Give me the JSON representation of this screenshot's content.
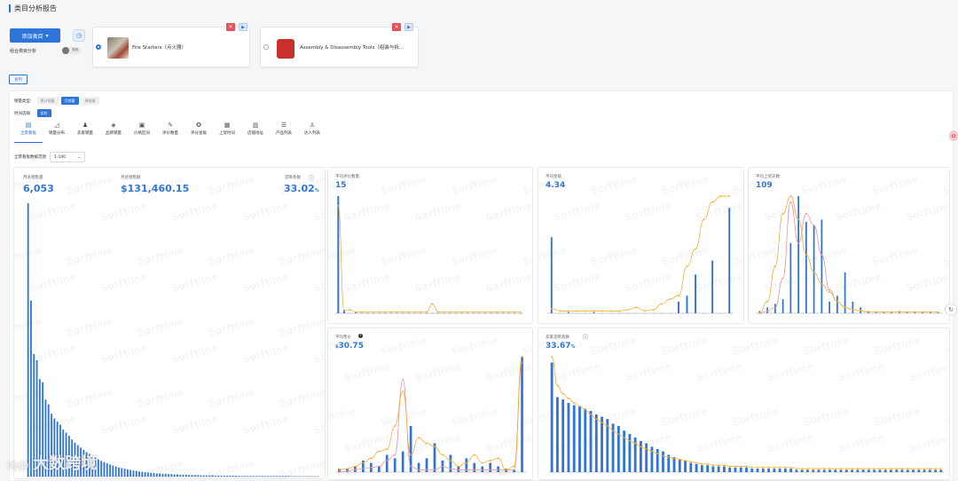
{
  "page": {
    "title": "类目分析报告"
  },
  "top": {
    "add_button": "添加类目",
    "combo_label": "组合类目分析",
    "toggle_text": "关闭",
    "categories": [
      {
        "name": "Fire Starters（点火器）",
        "selected": true
      },
      {
        "name": "Assembly & Disassembly Tools（组装与拆…",
        "selected": false
      }
    ],
    "list_tag": "发列"
  },
  "filters": {
    "sales_type_label": "销量类型:",
    "sales_types": [
      "累计销量",
      "月销量",
      "周销量"
    ],
    "sales_type_active": "月销量",
    "time_label": "时间选择:",
    "time_value": "实时"
  },
  "tabs": [
    {
      "label": "全景看板",
      "icon": "store-icon",
      "active": true
    },
    {
      "label": "销量分布",
      "icon": "chart-icon",
      "active": false
    },
    {
      "label": "卖家销量",
      "icon": "seller-icon",
      "active": false
    },
    {
      "label": "品牌销量",
      "icon": "brand-icon",
      "active": false
    },
    {
      "label": "价格区间",
      "icon": "price-icon",
      "active": false
    },
    {
      "label": "评价数量",
      "icon": "review-icon",
      "active": false
    },
    {
      "label": "评分星级",
      "icon": "star-icon",
      "active": false
    },
    {
      "label": "上架时间",
      "icon": "calendar-icon",
      "active": false
    },
    {
      "label": "店铺地址",
      "icon": "shop-icon",
      "active": false
    },
    {
      "label": "产品列表",
      "icon": "list-icon",
      "active": false
    },
    {
      "label": "达人列表",
      "icon": "creator-icon",
      "active": false
    }
  ],
  "range": {
    "label": "全景看板数据范围",
    "value": "1-100"
  },
  "summary": {
    "monthly_units_label": "月总销售量",
    "monthly_units": "6,053",
    "monthly_revenue_label": "月总销售额",
    "monthly_revenue": "$131,460.15",
    "monopoly_label": "垄断系数",
    "monopoly_value": "33.02",
    "monopoly_unit": "%"
  },
  "cards": {
    "reviews": {
      "label": "平均评价数量",
      "value": "15"
    },
    "rating": {
      "label": "平均星级",
      "value": "4.34"
    },
    "days": {
      "label": "平均上架天数",
      "value": "109"
    },
    "price": {
      "label": "平均售价",
      "currency": "$",
      "value": "30.75"
    },
    "concentration": {
      "label": "卖家垄断系数",
      "value": "33.67",
      "unit": "%"
    }
  },
  "watermark": "Sorftime",
  "brand_watermark": "大数跨境",
  "colors": {
    "accent": "#2f74d8",
    "orange": "#f5a623",
    "pink": "#e88a9b",
    "danger": "#e8505b"
  },
  "chart_data": [
    {
      "type": "bar",
      "title": "月总销售量",
      "values": [
        870,
        560,
        390,
        370,
        310,
        300,
        245,
        230,
        200,
        185,
        175,
        165,
        150,
        140,
        130,
        118,
        108,
        100,
        92,
        85,
        78,
        72,
        66,
        60,
        55,
        50,
        46,
        42,
        38,
        35,
        32,
        29,
        27,
        25,
        23,
        21,
        19,
        18,
        16,
        15,
        14,
        13,
        12,
        11,
        10,
        10,
        9,
        9,
        8,
        8,
        7,
        7,
        6,
        6,
        6,
        5,
        5,
        5,
        5,
        4,
        4,
        4,
        4,
        4,
        3,
        3,
        3,
        3,
        3,
        3,
        3,
        3,
        2,
        2,
        2,
        2,
        2,
        2,
        2,
        2,
        2,
        2,
        2,
        2,
        2,
        2,
        2,
        2,
        2,
        2,
        1,
        1,
        1,
        1,
        1,
        1,
        1,
        1,
        1,
        1
      ]
    },
    {
      "type": "bar",
      "title": "平均评价数量",
      "values": [
        100,
        3,
        0,
        1,
        0,
        0,
        0,
        0,
        0,
        0,
        0,
        0,
        0,
        0,
        0,
        0,
        0,
        0,
        0,
        0,
        0,
        0,
        0,
        0,
        0,
        0,
        0,
        0,
        0,
        0,
        0,
        0
      ],
      "line": [
        92,
        2,
        3,
        1,
        1,
        1,
        1,
        1,
        1,
        1,
        1,
        1,
        1,
        1,
        1,
        1,
        8,
        1,
        1,
        1,
        1,
        1,
        1,
        1,
        1,
        1,
        1,
        1,
        1,
        1,
        1,
        1
      ]
    },
    {
      "type": "bar",
      "title": "平均星级",
      "values": [
        65,
        0,
        1,
        0,
        0,
        1,
        0,
        0,
        0,
        0,
        0,
        0,
        0,
        0,
        0,
        10,
        15,
        33,
        0,
        45,
        0,
        90
      ],
      "line": [
        4,
        2,
        2,
        2,
        2,
        2,
        2,
        2,
        2,
        3,
        5,
        2,
        3,
        8,
        12,
        15,
        40,
        55,
        80,
        95,
        100,
        100
      ]
    },
    {
      "type": "bar",
      "title": "平均上架天数",
      "values": [
        2,
        5,
        8,
        12,
        60,
        100,
        78,
        75,
        80,
        10,
        15,
        35,
        10,
        5,
        2,
        1,
        1,
        1,
        2,
        1,
        1,
        1,
        1,
        1
      ],
      "line": [
        0,
        10,
        40,
        85,
        100,
        80,
        50,
        35,
        25,
        18,
        10,
        5,
        3,
        2,
        1,
        1,
        1,
        1,
        1,
        1,
        1,
        1,
        1,
        1
      ],
      "line2": [
        0,
        2,
        5,
        30,
        95,
        60,
        85,
        75,
        50,
        20,
        10,
        5,
        3,
        2,
        1,
        1,
        1,
        1,
        1,
        1,
        1,
        1,
        1,
        1
      ]
    },
    {
      "type": "bar",
      "title": "平均售价",
      "values": [
        3,
        3,
        5,
        10,
        8,
        5,
        15,
        12,
        18,
        40,
        8,
        12,
        25,
        10,
        15,
        5,
        12,
        8,
        5,
        8,
        5,
        3,
        2,
        100
      ],
      "line": [
        2,
        3,
        5,
        8,
        12,
        18,
        20,
        40,
        70,
        15,
        30,
        25,
        22,
        15,
        10,
        5,
        8,
        15,
        8,
        10,
        12,
        2,
        5,
        100
      ],
      "line2": [
        0,
        1,
        2,
        3,
        4,
        5,
        10,
        15,
        80,
        5,
        2,
        2,
        2,
        5,
        3,
        2,
        2,
        2,
        2,
        2,
        2,
        2,
        2,
        95
      ]
    },
    {
      "type": "bar",
      "title": "卖家垄断系数",
      "values": [
        95,
        65,
        63,
        60,
        58,
        57,
        55,
        53,
        50,
        48,
        46,
        42,
        40,
        36,
        33,
        30,
        27,
        25,
        22,
        20,
        18,
        15,
        13,
        11,
        10,
        8,
        7,
        6,
        6,
        5,
        5,
        5,
        4,
        4,
        4,
        4,
        3,
        3,
        3,
        3,
        3,
        3,
        3,
        3,
        2,
        2,
        2,
        2,
        2,
        2,
        2,
        2,
        2,
        2,
        2,
        2,
        2,
        2,
        2,
        2,
        2,
        2,
        2,
        2,
        2,
        2,
        2,
        2,
        2,
        2,
        2
      ],
      "line": [
        100,
        75,
        68,
        64,
        60,
        57,
        54,
        50,
        46,
        43,
        40,
        36,
        33,
        30,
        27,
        25,
        22,
        20,
        18,
        16,
        14,
        13,
        12,
        11,
        10,
        9,
        8,
        7,
        7,
        6,
        6,
        6,
        5,
        5,
        5,
        5,
        4,
        4,
        4,
        4,
        4,
        4,
        4,
        4,
        3,
        3,
        3,
        3,
        3,
        3,
        3,
        3,
        3,
        3,
        3,
        3,
        3,
        3,
        3,
        3,
        3,
        3,
        3,
        3,
        3,
        3,
        3,
        3,
        3,
        3,
        3
      ]
    }
  ]
}
